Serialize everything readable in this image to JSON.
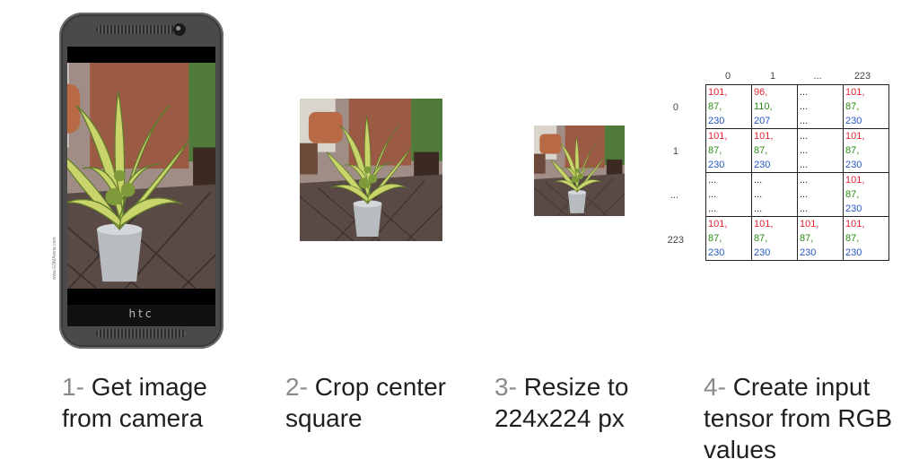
{
  "phone": {
    "brand": "htc",
    "side_text": "www.GSMArena.com"
  },
  "steps": [
    {
      "num": "1-",
      "line1": "Get image",
      "line2": "from camera",
      "line3": ""
    },
    {
      "num": "2-",
      "line1": "Crop center",
      "line2": "square",
      "line3": ""
    },
    {
      "num": "3-",
      "line1": "Resize to",
      "line2": "224x224 px",
      "line3": ""
    },
    {
      "num": "4-",
      "line1": "Create input",
      "line2": "tensor from RGB",
      "line3": "values"
    }
  ],
  "tensor": {
    "col_headers": [
      "0",
      "1",
      "...",
      "223"
    ],
    "row_headers": [
      "0",
      "1",
      "...",
      "223"
    ],
    "cells": [
      [
        [
          "101,",
          "87,",
          "230"
        ],
        [
          "96,",
          "110,",
          "207"
        ],
        [
          "...",
          "...",
          "..."
        ],
        [
          "101,",
          "87,",
          "230"
        ]
      ],
      [
        [
          "101,",
          "87,",
          "230"
        ],
        [
          "101,",
          "87,",
          "230"
        ],
        [
          "...",
          "...",
          "..."
        ],
        [
          "101,",
          "87,",
          "230"
        ]
      ],
      [
        [
          "...",
          "...",
          "..."
        ],
        [
          "...",
          "...",
          "..."
        ],
        [
          "...",
          "...",
          "..."
        ],
        [
          "101,",
          "87,",
          "230"
        ]
      ],
      [
        [
          "101,",
          "87,",
          "230"
        ],
        [
          "101,",
          "87,",
          "230"
        ],
        [
          "101,",
          "87,",
          "230"
        ],
        [
          "101,",
          "87,",
          "230"
        ]
      ]
    ]
  },
  "colors": {
    "red": "#e8232f",
    "green": "#2c8a12",
    "blue": "#2656c8",
    "phone_body": "#4a4a4c"
  }
}
